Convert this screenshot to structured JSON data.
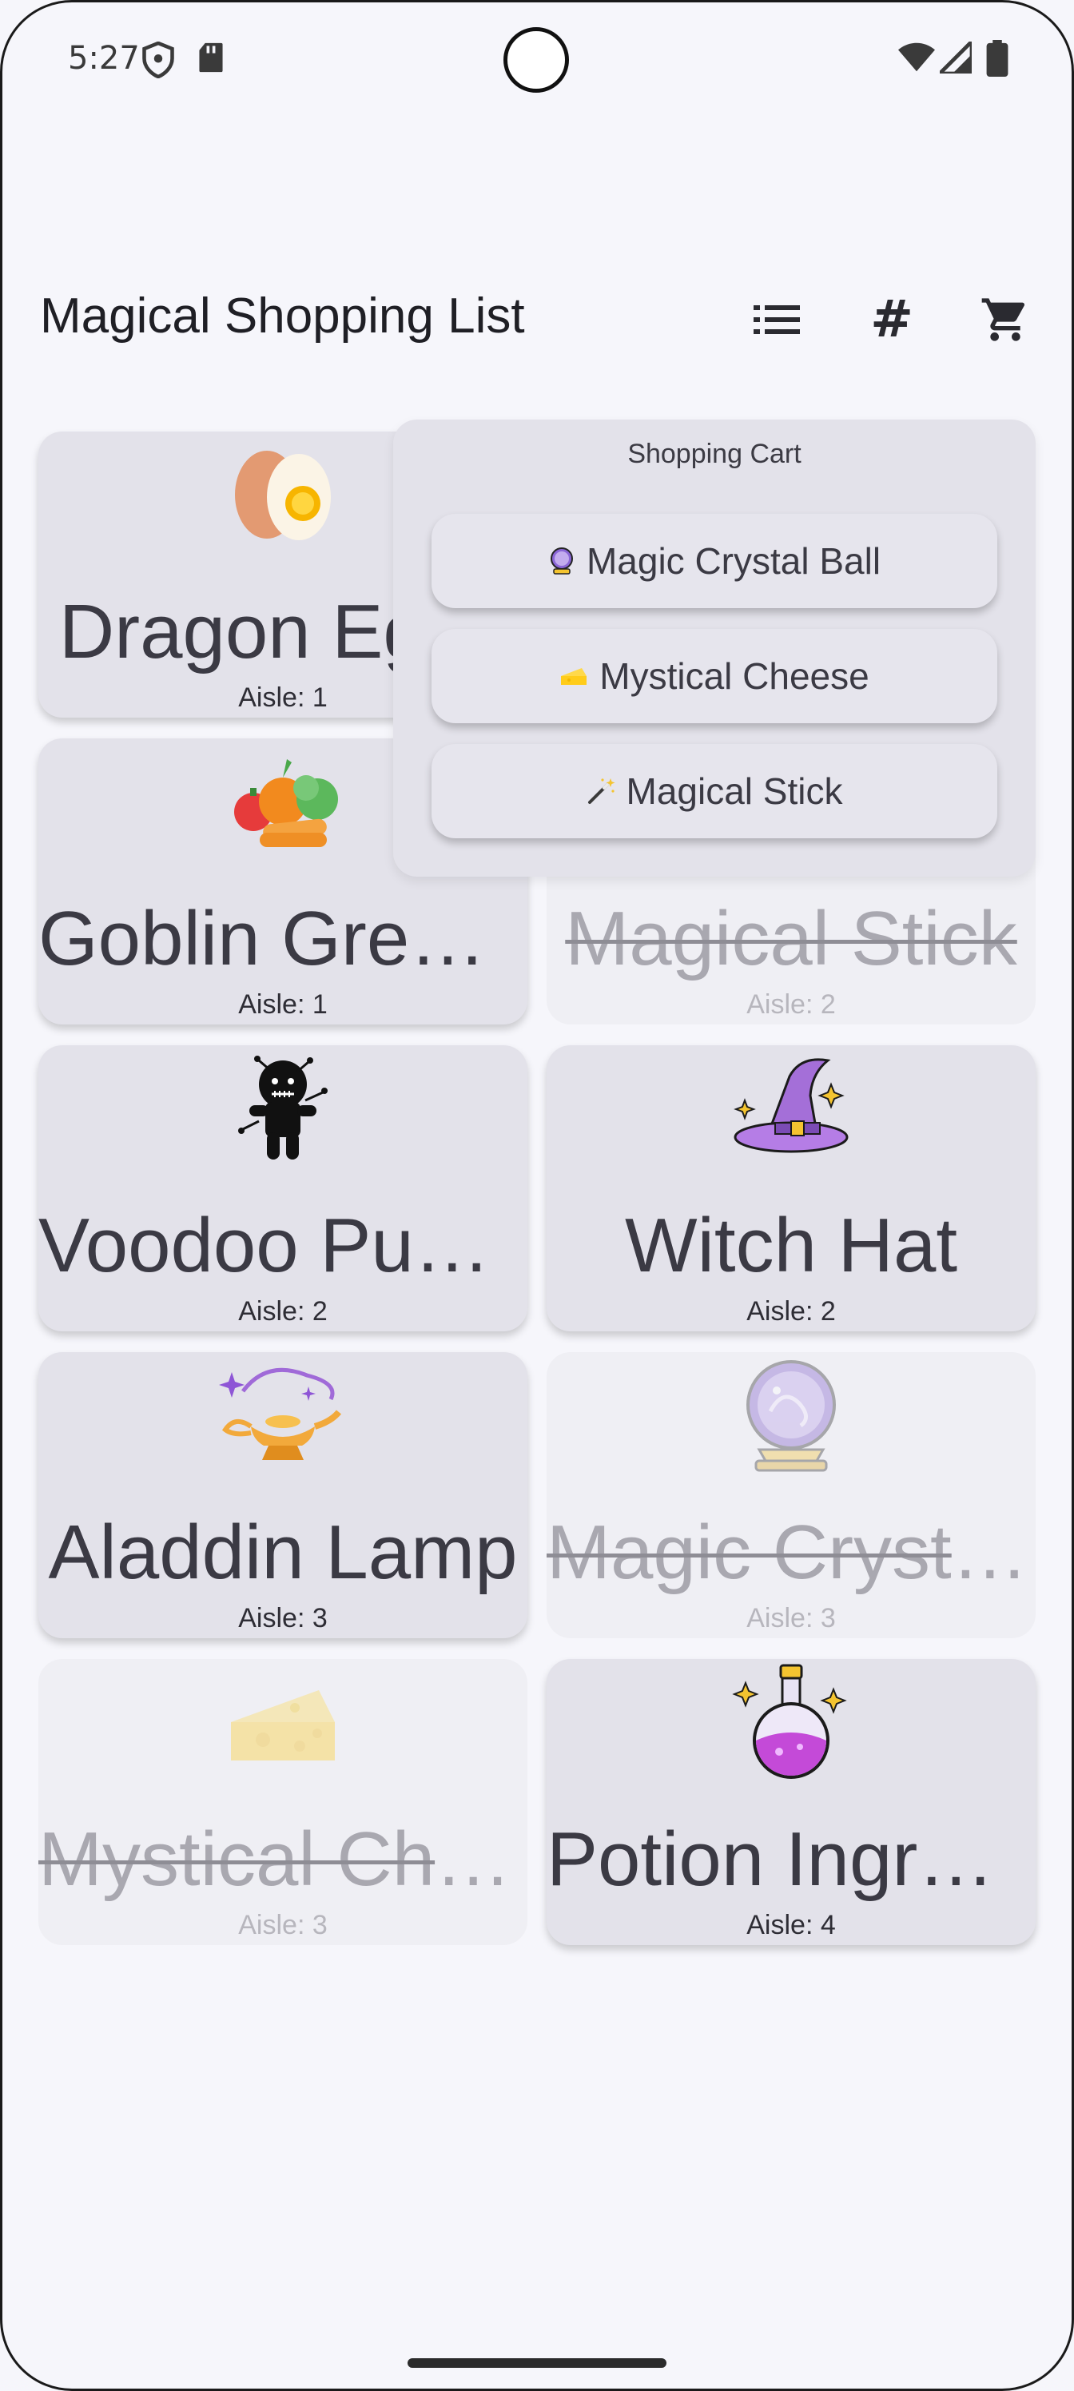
{
  "status_bar": {
    "time": "5:27",
    "icons": [
      "shield-icon",
      "sd-card-icon",
      "wifi-icon",
      "signal-icon",
      "battery-icon"
    ]
  },
  "app_bar": {
    "title": "Magical Shopping List",
    "actions": [
      {
        "name": "list-view",
        "icon": "list-icon"
      },
      {
        "name": "number-view",
        "icon": "hash-icon",
        "glyph": "#"
      },
      {
        "name": "shopping-cart",
        "icon": "cart-icon"
      }
    ]
  },
  "items": [
    {
      "name": "Dragon Eggs",
      "aisle": "Aisle: 1",
      "icon": "egg-icon",
      "in_cart": false
    },
    {
      "name": "Goblin Greens",
      "aisle": "Aisle: 1",
      "icon": "vegetables-icon",
      "in_cart": false
    },
    {
      "name": "Magical Stick",
      "aisle": "Aisle: 2",
      "icon": "magic-wand-icon",
      "in_cart": true
    },
    {
      "name": "Voodoo Puppet",
      "aisle": "Aisle: 2",
      "icon": "voodoo-doll-icon",
      "in_cart": false
    },
    {
      "name": "Witch Hat",
      "aisle": "Aisle: 2",
      "icon": "witch-hat-icon",
      "in_cart": false
    },
    {
      "name": "Aladdin Lamp",
      "aisle": "Aisle: 3",
      "icon": "magic-lamp-icon",
      "in_cart": false
    },
    {
      "name": "Magic Crystal Ball",
      "aisle": "Aisle: 3",
      "icon": "crystal-ball-icon",
      "in_cart": true
    },
    {
      "name": "Mystical Cheese",
      "aisle": "Aisle: 3",
      "icon": "cheese-icon",
      "in_cart": true
    },
    {
      "name": "Potion Ingredients",
      "aisle": "Aisle: 4",
      "icon": "potion-icon",
      "in_cart": false
    }
  ],
  "cart_popup": {
    "heading": "Shopping Cart",
    "items": [
      {
        "label": "Magic Crystal Ball",
        "icon": "crystal-ball-icon"
      },
      {
        "label": "Mystical Cheese",
        "icon": "cheese-icon"
      },
      {
        "label": "Magical Stick",
        "icon": "magic-wand-icon"
      }
    ]
  }
}
